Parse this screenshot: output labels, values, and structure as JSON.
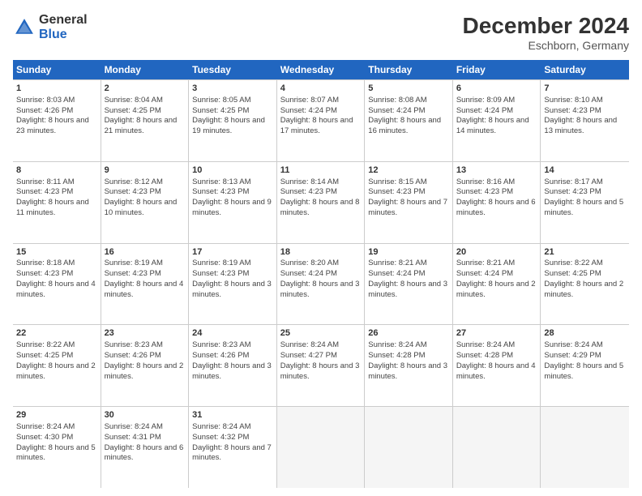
{
  "header": {
    "logo_general": "General",
    "logo_blue": "Blue",
    "month": "December 2024",
    "location": "Eschborn, Germany"
  },
  "weekdays": [
    "Sunday",
    "Monday",
    "Tuesday",
    "Wednesday",
    "Thursday",
    "Friday",
    "Saturday"
  ],
  "rows": [
    [
      {
        "day": "1",
        "info": "Sunrise: 8:03 AM\nSunset: 4:26 PM\nDaylight: 8 hours and 23 minutes."
      },
      {
        "day": "2",
        "info": "Sunrise: 8:04 AM\nSunset: 4:25 PM\nDaylight: 8 hours and 21 minutes."
      },
      {
        "day": "3",
        "info": "Sunrise: 8:05 AM\nSunset: 4:25 PM\nDaylight: 8 hours and 19 minutes."
      },
      {
        "day": "4",
        "info": "Sunrise: 8:07 AM\nSunset: 4:24 PM\nDaylight: 8 hours and 17 minutes."
      },
      {
        "day": "5",
        "info": "Sunrise: 8:08 AM\nSunset: 4:24 PM\nDaylight: 8 hours and 16 minutes."
      },
      {
        "day": "6",
        "info": "Sunrise: 8:09 AM\nSunset: 4:24 PM\nDaylight: 8 hours and 14 minutes."
      },
      {
        "day": "7",
        "info": "Sunrise: 8:10 AM\nSunset: 4:23 PM\nDaylight: 8 hours and 13 minutes."
      }
    ],
    [
      {
        "day": "8",
        "info": "Sunrise: 8:11 AM\nSunset: 4:23 PM\nDaylight: 8 hours and 11 minutes."
      },
      {
        "day": "9",
        "info": "Sunrise: 8:12 AM\nSunset: 4:23 PM\nDaylight: 8 hours and 10 minutes."
      },
      {
        "day": "10",
        "info": "Sunrise: 8:13 AM\nSunset: 4:23 PM\nDaylight: 8 hours and 9 minutes."
      },
      {
        "day": "11",
        "info": "Sunrise: 8:14 AM\nSunset: 4:23 PM\nDaylight: 8 hours and 8 minutes."
      },
      {
        "day": "12",
        "info": "Sunrise: 8:15 AM\nSunset: 4:23 PM\nDaylight: 8 hours and 7 minutes."
      },
      {
        "day": "13",
        "info": "Sunrise: 8:16 AM\nSunset: 4:23 PM\nDaylight: 8 hours and 6 minutes."
      },
      {
        "day": "14",
        "info": "Sunrise: 8:17 AM\nSunset: 4:23 PM\nDaylight: 8 hours and 5 minutes."
      }
    ],
    [
      {
        "day": "15",
        "info": "Sunrise: 8:18 AM\nSunset: 4:23 PM\nDaylight: 8 hours and 4 minutes."
      },
      {
        "day": "16",
        "info": "Sunrise: 8:19 AM\nSunset: 4:23 PM\nDaylight: 8 hours and 4 minutes."
      },
      {
        "day": "17",
        "info": "Sunrise: 8:19 AM\nSunset: 4:23 PM\nDaylight: 8 hours and 3 minutes."
      },
      {
        "day": "18",
        "info": "Sunrise: 8:20 AM\nSunset: 4:24 PM\nDaylight: 8 hours and 3 minutes."
      },
      {
        "day": "19",
        "info": "Sunrise: 8:21 AM\nSunset: 4:24 PM\nDaylight: 8 hours and 3 minutes."
      },
      {
        "day": "20",
        "info": "Sunrise: 8:21 AM\nSunset: 4:24 PM\nDaylight: 8 hours and 2 minutes."
      },
      {
        "day": "21",
        "info": "Sunrise: 8:22 AM\nSunset: 4:25 PM\nDaylight: 8 hours and 2 minutes."
      }
    ],
    [
      {
        "day": "22",
        "info": "Sunrise: 8:22 AM\nSunset: 4:25 PM\nDaylight: 8 hours and 2 minutes."
      },
      {
        "day": "23",
        "info": "Sunrise: 8:23 AM\nSunset: 4:26 PM\nDaylight: 8 hours and 2 minutes."
      },
      {
        "day": "24",
        "info": "Sunrise: 8:23 AM\nSunset: 4:26 PM\nDaylight: 8 hours and 3 minutes."
      },
      {
        "day": "25",
        "info": "Sunrise: 8:24 AM\nSunset: 4:27 PM\nDaylight: 8 hours and 3 minutes."
      },
      {
        "day": "26",
        "info": "Sunrise: 8:24 AM\nSunset: 4:28 PM\nDaylight: 8 hours and 3 minutes."
      },
      {
        "day": "27",
        "info": "Sunrise: 8:24 AM\nSunset: 4:28 PM\nDaylight: 8 hours and 4 minutes."
      },
      {
        "day": "28",
        "info": "Sunrise: 8:24 AM\nSunset: 4:29 PM\nDaylight: 8 hours and 5 minutes."
      }
    ],
    [
      {
        "day": "29",
        "info": "Sunrise: 8:24 AM\nSunset: 4:30 PM\nDaylight: 8 hours and 5 minutes."
      },
      {
        "day": "30",
        "info": "Sunrise: 8:24 AM\nSunset: 4:31 PM\nDaylight: 8 hours and 6 minutes."
      },
      {
        "day": "31",
        "info": "Sunrise: 8:24 AM\nSunset: 4:32 PM\nDaylight: 8 hours and 7 minutes."
      },
      {
        "day": "",
        "info": ""
      },
      {
        "day": "",
        "info": ""
      },
      {
        "day": "",
        "info": ""
      },
      {
        "day": "",
        "info": ""
      }
    ]
  ]
}
